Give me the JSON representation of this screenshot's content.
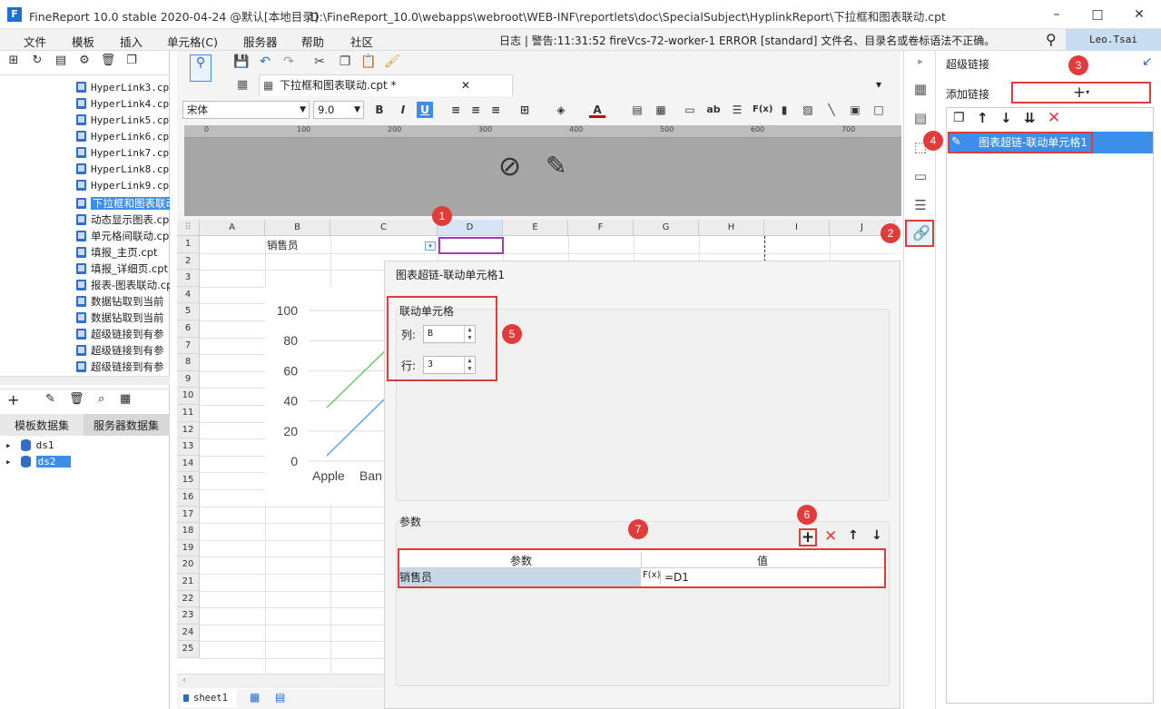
{
  "app": {
    "title": "FineReport 10.0 stable 2020-04-24 @默认[本地目录]",
    "path": "D:\\FineReport_10.0\\webapps\\webroot\\WEB-INF\\reportlets\\doc\\SpecialSubject\\HyplinkReport\\下拉框和图表联动.cpt"
  },
  "menu": {
    "items": [
      "文件",
      "模板",
      "插入",
      "单元格(C)",
      "服务器",
      "帮助",
      "社区"
    ],
    "log": "日志 | 警告:11:31:52 fireVcs-72-worker-1 ERROR [standard] 文件名、目录名或卷标语法不正确。",
    "user": "Leo.Tsai"
  },
  "tree": {
    "items": [
      "HyperLink3.cpt",
      "HyperLink4.cpt",
      "HyperLink5.cpt",
      "HyperLink6.cpt",
      "HyperLink7.cpt",
      "HyperLink8.cpt",
      "HyperLink9.cpt",
      "下拉框和图表联动.cpt",
      "动态显示图表.cpt",
      "单元格间联动.cpt",
      "填报_主页.cpt",
      "填报_详细页.cpt",
      "报表-图表联动.cpt",
      "数据钻取到当前",
      "数据钻取到当前",
      "超级链接到有参",
      "超级链接到有参",
      "超级链接到有参"
    ]
  },
  "datasets": {
    "tab_template": "模板数据集",
    "tab_server": "服务器数据集",
    "items": [
      "ds1",
      "ds2"
    ]
  },
  "editor": {
    "tab_label": "下拉框和图表联动.cpt *",
    "font": "宋体",
    "font_size": "9.0"
  },
  "grid": {
    "columns": [
      "A",
      "B",
      "C",
      "D",
      "E",
      "F",
      "G",
      "H",
      "I",
      "J"
    ],
    "rows": [
      "1",
      "2",
      "3",
      "4",
      "5",
      "6",
      "7",
      "8",
      "9",
      "10",
      "11",
      "12",
      "13",
      "14",
      "15",
      "16",
      "17",
      "18",
      "19",
      "20",
      "21",
      "22",
      "23",
      "24",
      "25"
    ],
    "b1": "销售员",
    "sheet": "sheet1"
  },
  "chart_data": {
    "type": "line",
    "ylim": [
      0,
      100
    ],
    "yticks": [
      "100",
      "80",
      "60",
      "40",
      "20",
      "0"
    ],
    "categories": [
      "Apple",
      "Ban"
    ]
  },
  "dialog": {
    "title": "图表超链-联动单元格1",
    "group_label": "联动单元格",
    "col_label": "列:",
    "col_value": "B",
    "row_label": "行:",
    "row_value": "3",
    "params_label": "参数",
    "th_param": "参数",
    "th_value": "值",
    "row_param": "销售员",
    "row_formula": "=D1"
  },
  "right": {
    "title": "超级链接",
    "add_label": "添加链接",
    "link_item": "图表超链-联动单元格1"
  },
  "badges": [
    "1",
    "2",
    "3",
    "4",
    "5",
    "6",
    "7"
  ]
}
